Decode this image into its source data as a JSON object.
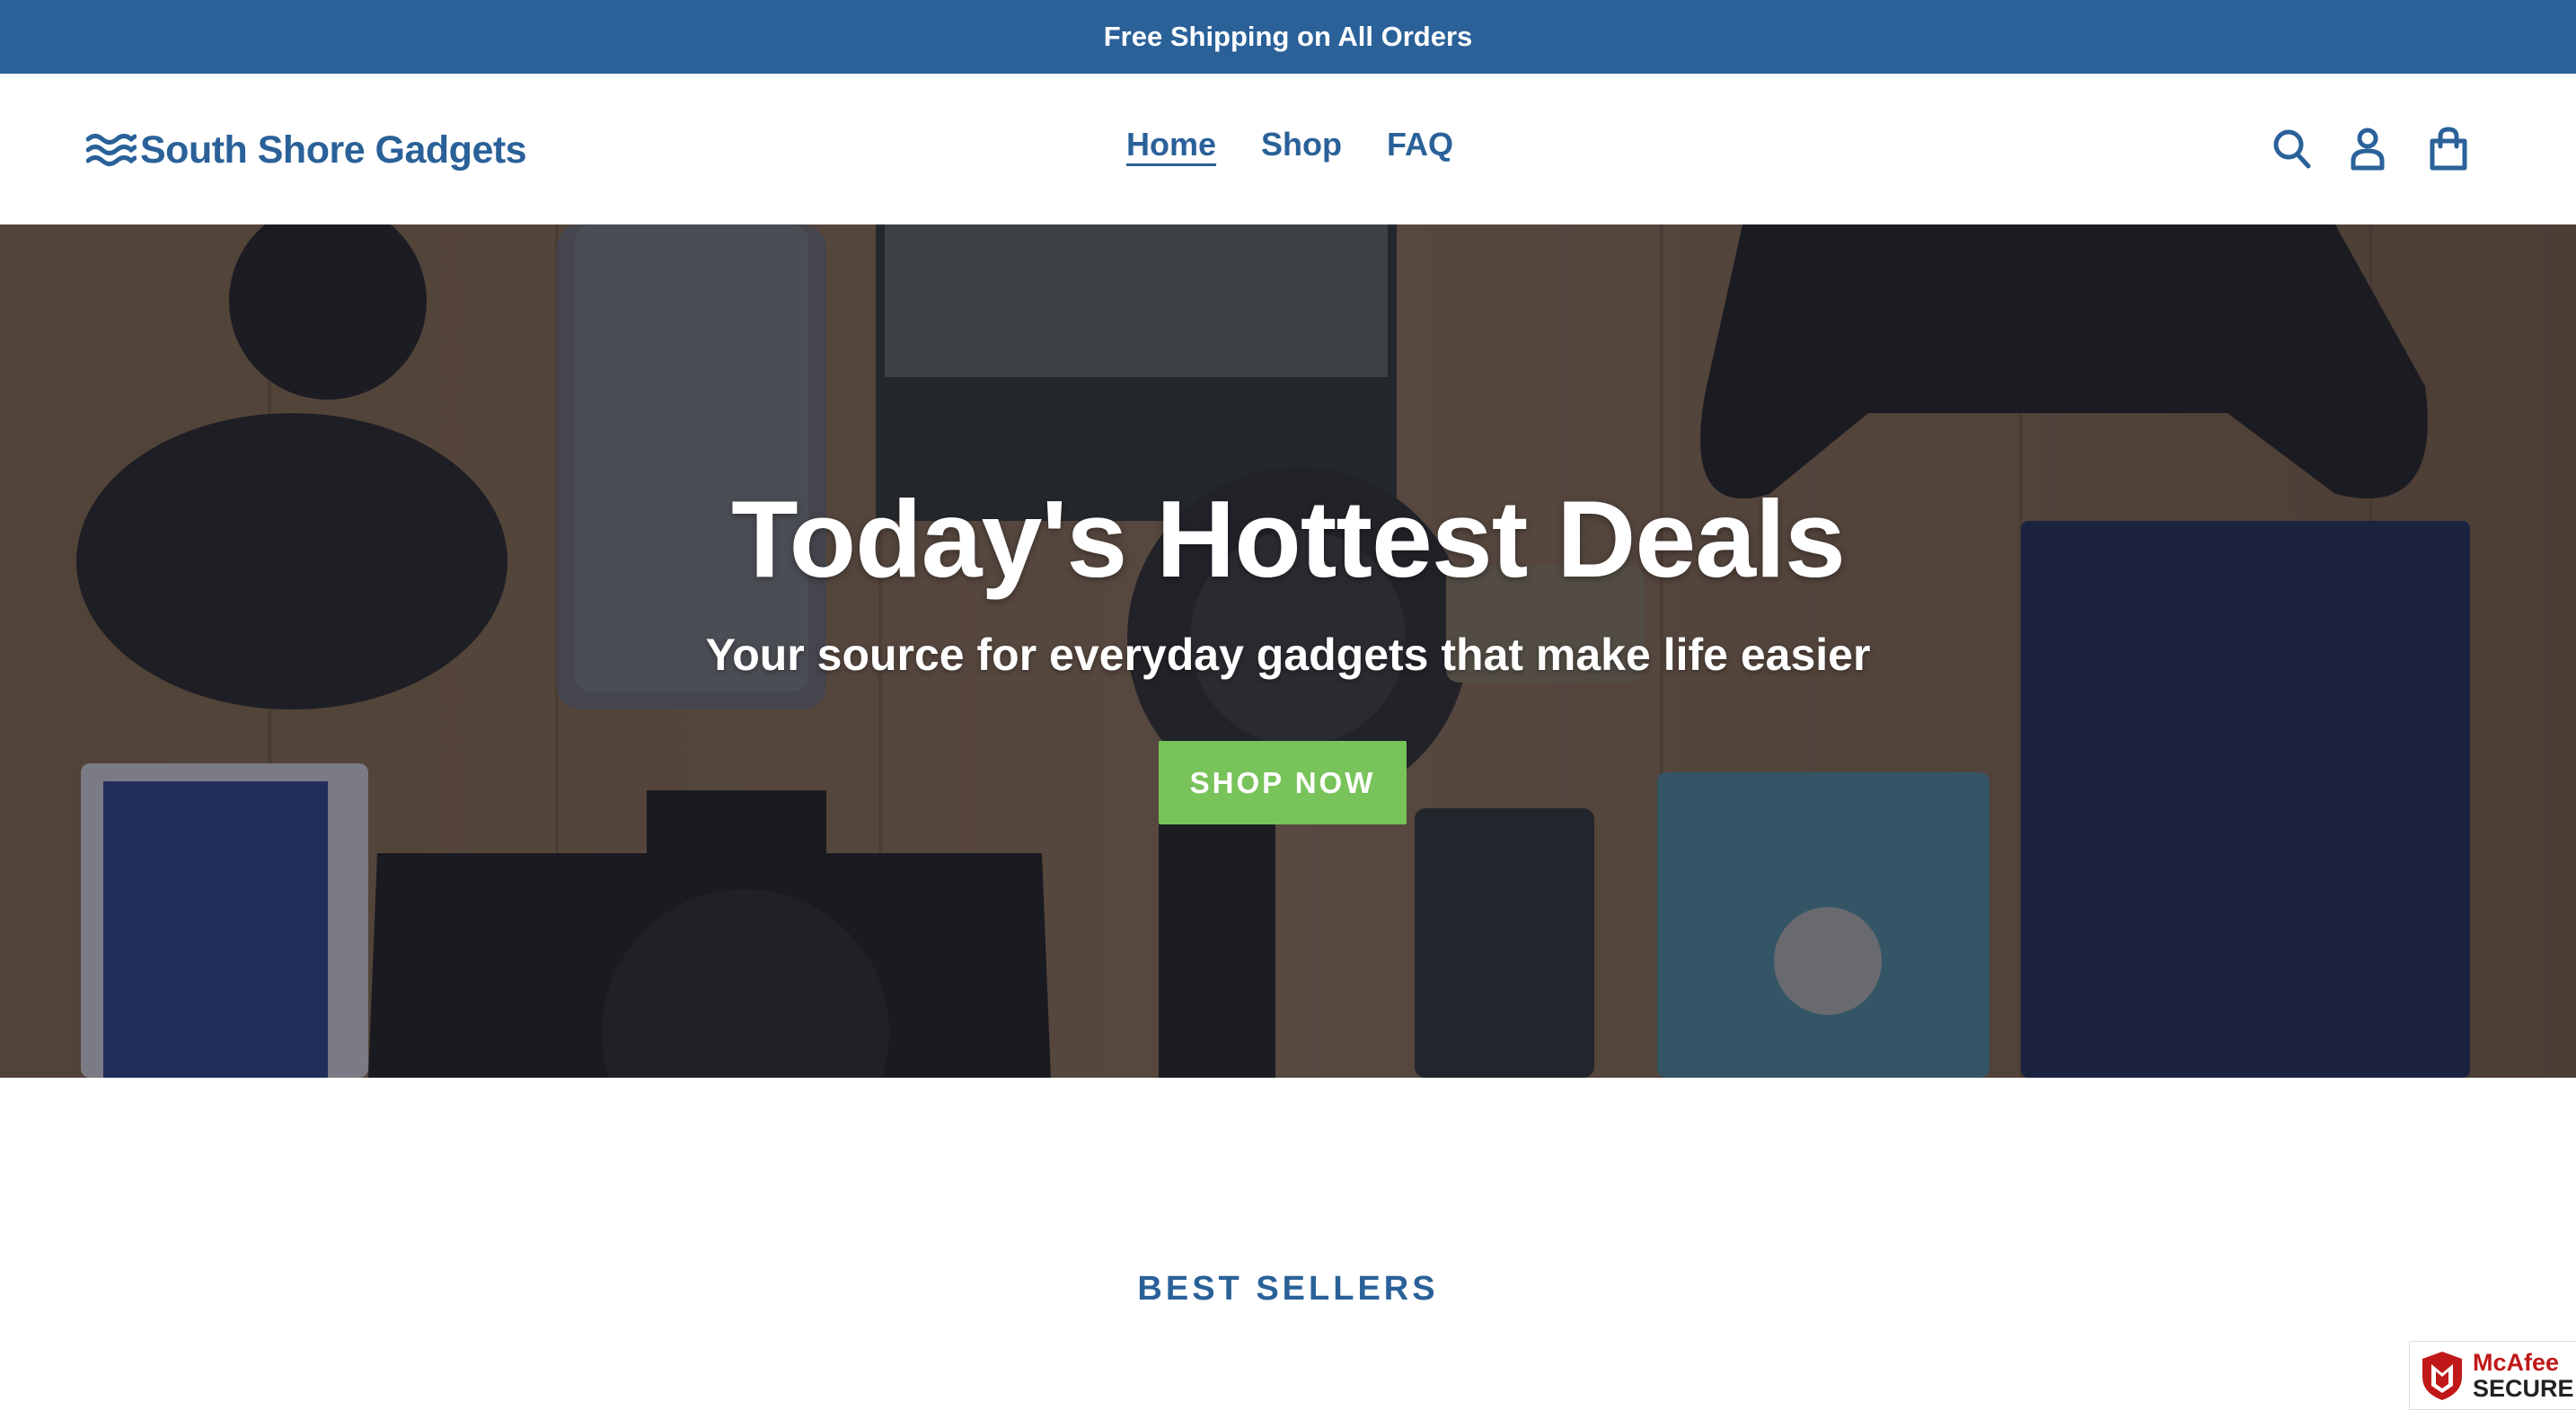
{
  "announcement": {
    "text": "Free Shipping on All Orders"
  },
  "header": {
    "logo_text": "South Shore Gadgets",
    "logo_icon": "waves-icon",
    "nav": [
      {
        "label": "Home",
        "active": true
      },
      {
        "label": "Shop",
        "active": false
      },
      {
        "label": "FAQ",
        "active": false
      }
    ],
    "icons": [
      "search-icon",
      "account-icon",
      "cart-icon"
    ]
  },
  "hero": {
    "title": "Today's Hottest Deals",
    "subtitle": "Your source for everyday gadgets that make life easier",
    "button_label": "SHOP NOW",
    "image_alt": "Flat lay of gadgets on a wooden table"
  },
  "best_sellers": {
    "title": "BEST SELLERS"
  },
  "badge": {
    "brand": "McAfee",
    "label": "SECURE"
  },
  "colors": {
    "brand_blue": "#2a6199",
    "button_green": "#78c35a",
    "badge_red": "#c01818"
  }
}
